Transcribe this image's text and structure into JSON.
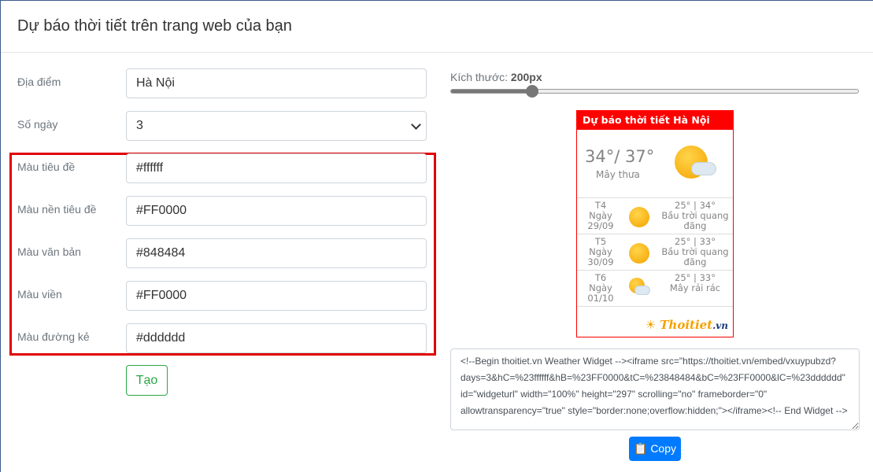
{
  "header": {
    "title": "Dự báo thời tiết trên trang web của bạn"
  },
  "form": {
    "location": {
      "label": "Địa điểm",
      "value": "Hà Nội"
    },
    "days": {
      "label": "Số ngày",
      "value": "3"
    },
    "title_color": {
      "label": "Màu tiêu đề",
      "value": "#ffffff"
    },
    "title_bg": {
      "label": "Màu nền tiêu đề",
      "value": "#FF0000"
    },
    "text_color": {
      "label": "Màu văn bản",
      "value": "#848484"
    },
    "border_color": {
      "label": "Màu viền",
      "value": "#FF0000"
    },
    "line_color": {
      "label": "Màu đường kẻ",
      "value": "#dddddd"
    },
    "create_button": "Tạo",
    "highlight_color": "#e00000"
  },
  "size": {
    "label": "Kích thước:",
    "value": "200px",
    "slider_percent": 20
  },
  "widget": {
    "title": "Dự báo thời tiết Hà Nội",
    "current": {
      "temp": "34°/ 37°",
      "desc": "Mây thưa",
      "icon": "sun-cloud-icon"
    },
    "days": [
      {
        "dow": "T4",
        "day": "Ngày",
        "date": "29/09",
        "temp": "25° | 34°",
        "desc": "Bầu trời quang đãng",
        "icon": "sun-icon"
      },
      {
        "dow": "T5",
        "day": "Ngày",
        "date": "30/09",
        "temp": "25° | 33°",
        "desc": "Bầu trời quang đãng",
        "icon": "sun-icon"
      },
      {
        "dow": "T6",
        "day": "Ngày",
        "date": "01/10",
        "temp": "25° | 33°",
        "desc": "Mây rải rác",
        "icon": "sun-cloud-icon"
      }
    ],
    "logo": "Thoitiet.vn"
  },
  "embed_code": "<!--Begin thoitiet.vn Weather Widget --><iframe src=\"https://thoitiet.vn/embed/vxuypubzd?days=3&hC=%23ffffff&hB=%23FF0000&tC=%23848484&bC=%23FF0000&lC=%23dddddd\" id=\"widgeturl\" width=\"100%\" height=\"297\" scrolling=\"no\" frameborder=\"0\" allowtransparency=\"true\" style=\"border:none;overflow:hidden;\"></iframe><!-- End Widget -->",
  "copy_button": "Copy"
}
